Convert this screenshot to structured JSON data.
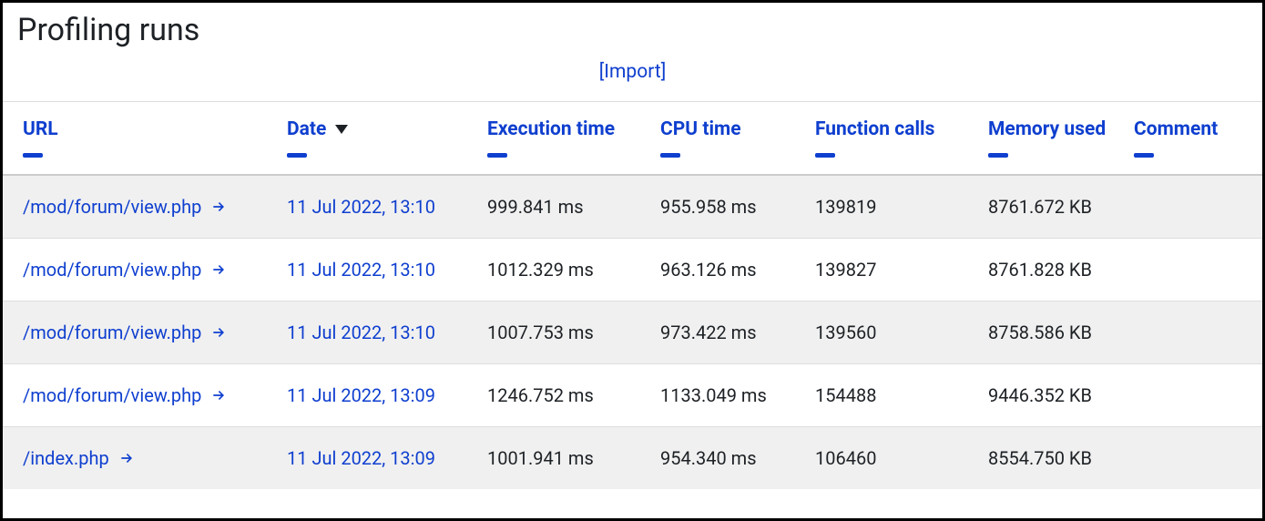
{
  "page": {
    "title": "Profiling runs",
    "import_label": "[Import]"
  },
  "columns": {
    "url": "URL",
    "date": "Date",
    "exec": "Execution time",
    "cpu": "CPU time",
    "func": "Function calls",
    "mem": "Memory used",
    "comment": "Comment"
  },
  "rows": [
    {
      "url": "/mod/forum/view.php",
      "date": "11 Jul 2022, 13:10",
      "exec": "999.841 ms",
      "cpu": "955.958 ms",
      "func": "139819",
      "mem": "8761.672 KB",
      "comment": ""
    },
    {
      "url": "/mod/forum/view.php",
      "date": "11 Jul 2022, 13:10",
      "exec": "1012.329 ms",
      "cpu": "963.126 ms",
      "func": "139827",
      "mem": "8761.828 KB",
      "comment": ""
    },
    {
      "url": "/mod/forum/view.php",
      "date": "11 Jul 2022, 13:10",
      "exec": "1007.753 ms",
      "cpu": "973.422 ms",
      "func": "139560",
      "mem": "8758.586 KB",
      "comment": ""
    },
    {
      "url": "/mod/forum/view.php",
      "date": "11 Jul 2022, 13:09",
      "exec": "1246.752 ms",
      "cpu": "1133.049 ms",
      "func": "154488",
      "mem": "9446.352 KB",
      "comment": ""
    },
    {
      "url": "/index.php",
      "date": "11 Jul 2022, 13:09",
      "exec": "1001.941 ms",
      "cpu": "954.340 ms",
      "func": "106460",
      "mem": "8554.750 KB",
      "comment": ""
    }
  ]
}
